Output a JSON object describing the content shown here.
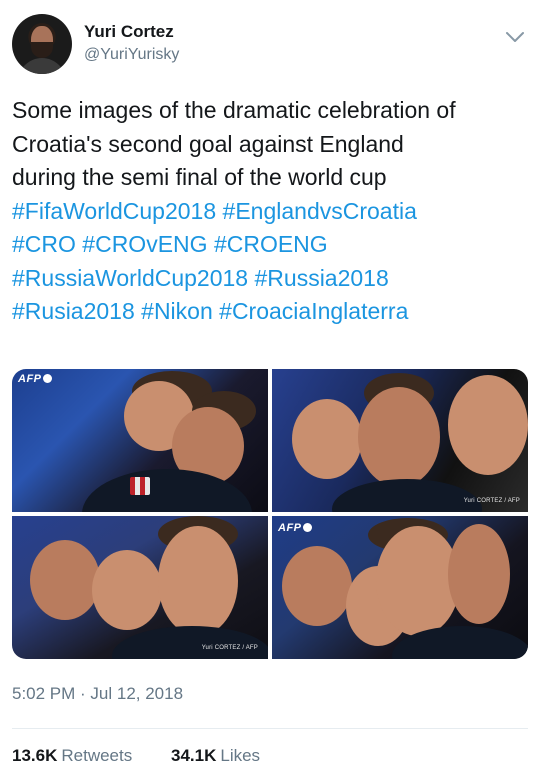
{
  "tweet": {
    "author": {
      "display_name": "Yuri Cortez",
      "handle": "@YuriYurisky"
    },
    "text_lines": [
      "Some images of the dramatic celebration of",
      "Croatia's second goal against England",
      "during the semi final of the world cup"
    ],
    "hashtag_lines": [
      [
        "#FifaWorldCup2018",
        "#EnglandvsCroatia"
      ],
      [
        "#CRO",
        "#CROvENG",
        "#CROENG"
      ],
      [
        "#RussiaWorldCup2018",
        "#Russia2018"
      ],
      [
        "#Rusia2018",
        "#Nikon",
        "#CroaciaInglaterra"
      ]
    ],
    "media": {
      "photos": [
        {
          "watermark": "AFP",
          "credit": ""
        },
        {
          "watermark": "",
          "credit": "Yuri CORTEZ / AFP"
        },
        {
          "watermark": "",
          "credit": "Yuri CORTEZ / AFP"
        },
        {
          "watermark": "AFP",
          "credit": ""
        }
      ]
    },
    "timestamp": "5:02 PM · Jul 12, 2018",
    "stats": {
      "retweets_count": "13.6K",
      "retweets_label": "Retweets",
      "likes_count": "34.1K",
      "likes_label": "Likes"
    }
  },
  "icons": {
    "menu_caret": "chevron-down-icon"
  },
  "colors": {
    "link": "#1b95e0",
    "secondary_text": "#657786",
    "primary_text": "#14171a"
  }
}
